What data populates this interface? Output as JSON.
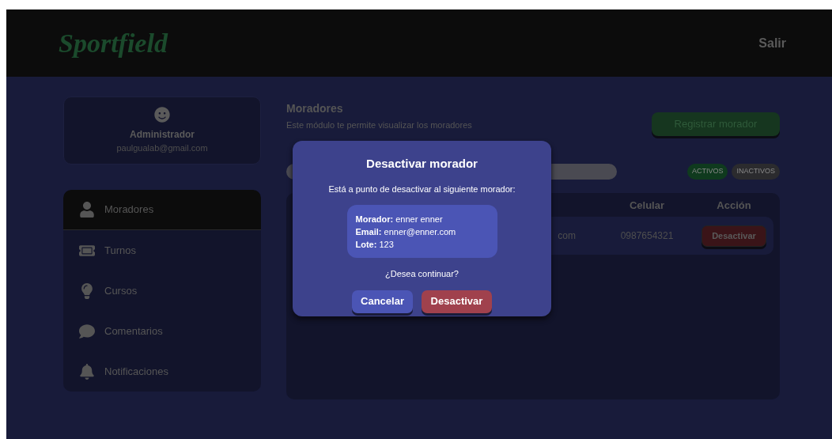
{
  "header": {
    "logo": "Sportfield",
    "logout": "Salir"
  },
  "profile": {
    "role": "Administrador",
    "email": "paulgualab@gmail.com"
  },
  "menu": [
    {
      "label": "Moradores",
      "kind": "user",
      "selected": true
    },
    {
      "label": "Turnos",
      "kind": "ticket",
      "selected": false
    },
    {
      "label": "Cursos",
      "kind": "bulb",
      "selected": false
    },
    {
      "label": "Comentarios",
      "kind": "comment",
      "selected": false
    },
    {
      "label": "Notificaciones",
      "kind": "bell",
      "selected": false
    }
  ],
  "page": {
    "title": "Moradores",
    "description": "Este módulo te permite visualizar los moradores",
    "register_button": "Registrar morador"
  },
  "filters": [
    {
      "label": "ACTIVOS",
      "color": "#0f3a1e"
    },
    {
      "label": "INACTIVOS",
      "color": "#2b2b2e"
    }
  ],
  "table": {
    "columns": [
      "Celular",
      "Acción"
    ],
    "rows": [
      {
        "email": "com",
        "phone": "0987654321",
        "action": "Desactivar"
      }
    ]
  },
  "modal": {
    "title": "Desactivar morador",
    "message": "Está a punto de desactivar al siguiente morador:",
    "details": [
      {
        "label": "Morador:",
        "value": "enner enner"
      },
      {
        "label": "Email:",
        "value": "enner@enner.com"
      },
      {
        "label": "Lote:",
        "value": "123"
      }
    ],
    "question": "¿Desea continuar?",
    "cancel": "Cancelar",
    "confirm": "Desactivar"
  }
}
